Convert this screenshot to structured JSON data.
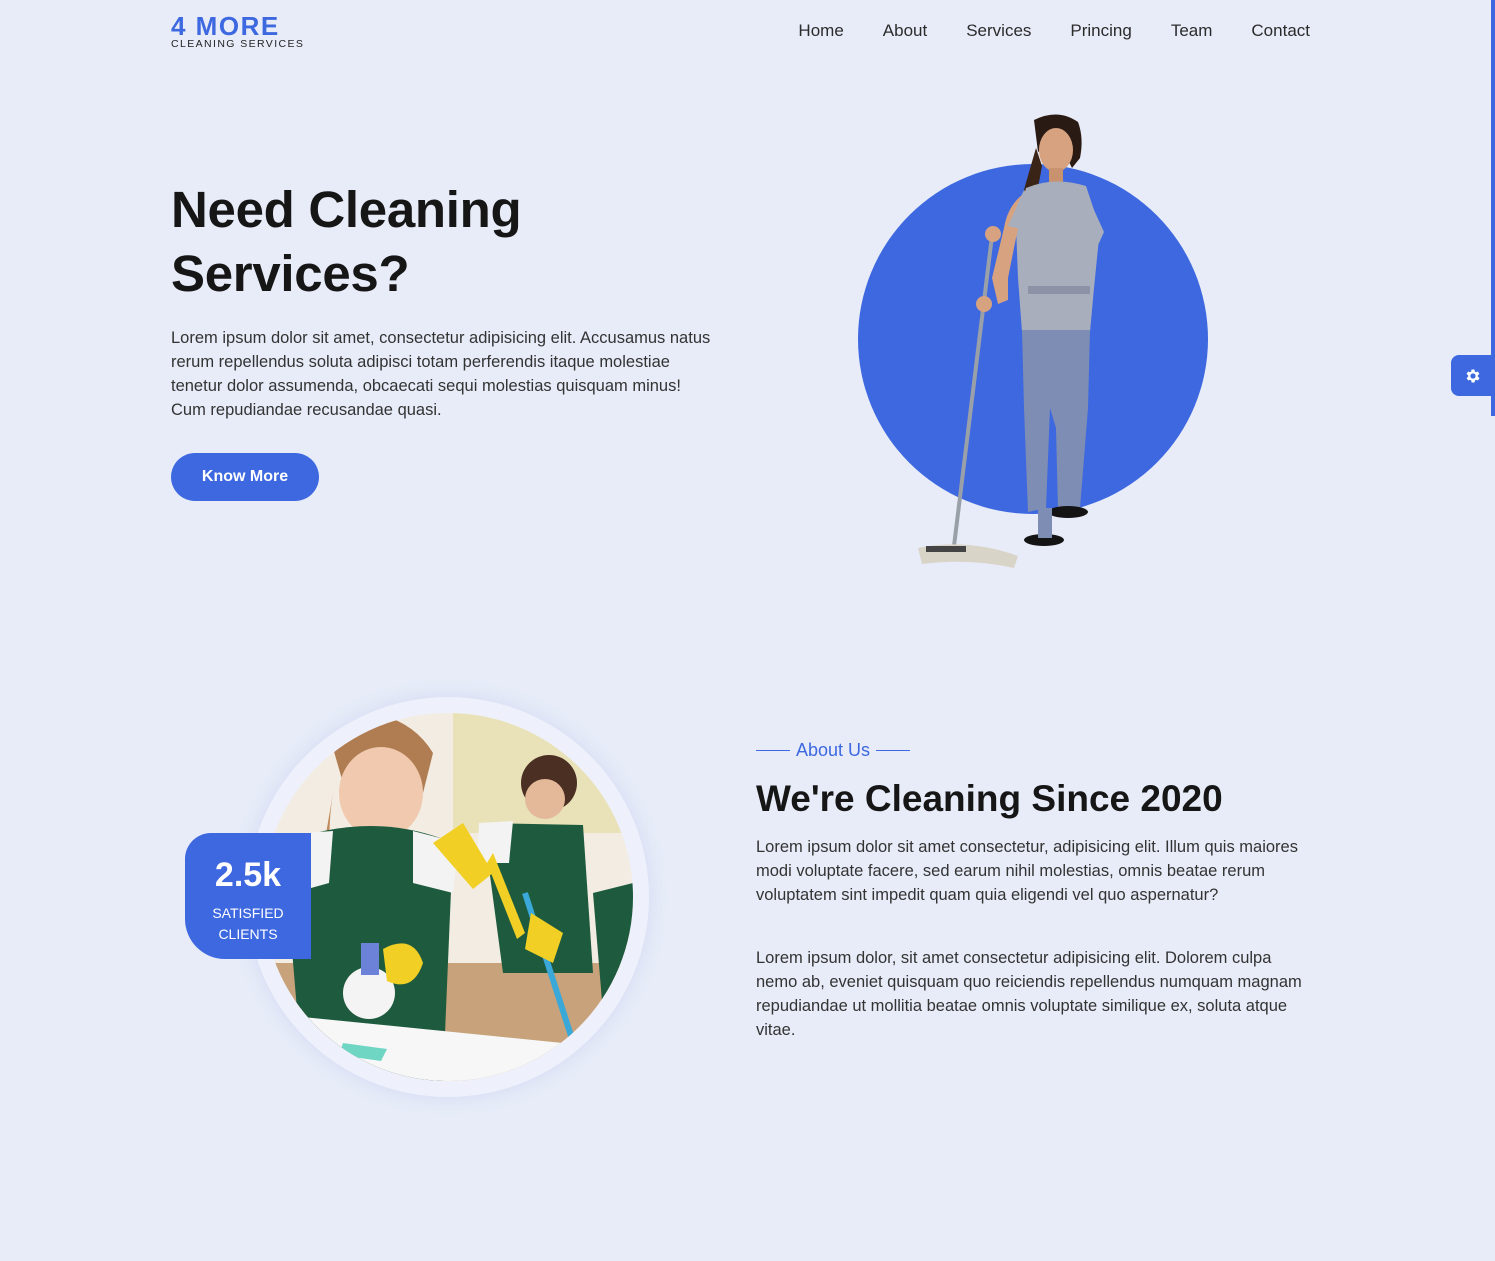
{
  "brand": {
    "name": "4 MORE",
    "tagline": "CLEANING SERVICES",
    "accent": "#3d68e0"
  },
  "nav": {
    "items": [
      {
        "label": "Home"
      },
      {
        "label": "About"
      },
      {
        "label": "Services"
      },
      {
        "label": "Princing"
      },
      {
        "label": "Team"
      },
      {
        "label": "Contact"
      }
    ]
  },
  "hero": {
    "title": "Need Cleaning Services?",
    "text": "Lorem ipsum dolor sit amet, consectetur adipisicing elit. Accusamus natus rerum repellendus soluta adipisci totam perferendis itaque molestiae tenetur dolor assumenda, obcaecati sequi molestias quisquam minus! Cum repudiandae recusandae quasi.",
    "button": "Know More",
    "image": "woman-with-mop-photo"
  },
  "about": {
    "eyebrow": "About Us",
    "title": "We're Cleaning Since 2020",
    "p1": "Lorem ipsum dolor sit amet consectetur, adipisicing elit. Illum quis maiores modi voluptate facere, sed earum nihil molestias, omnis beatae rerum voluptatem sint impedit quam quia eligendi vel quo aspernatur?",
    "p2": "Lorem ipsum dolor, sit amet consectetur adipisicing elit. Dolorem culpa nemo ab, eveniet quisquam quo reiciendis repellendus numquam magnam repudiandae ut mollitia beatae omnis voluptate similique ex, soluta atque vitae.",
    "image": "cleaners-team-photo",
    "stat": {
      "number": "2.5k",
      "label": "SATISFIED CLIENTS"
    }
  },
  "widgets": {
    "settings_icon": "gear-icon"
  }
}
